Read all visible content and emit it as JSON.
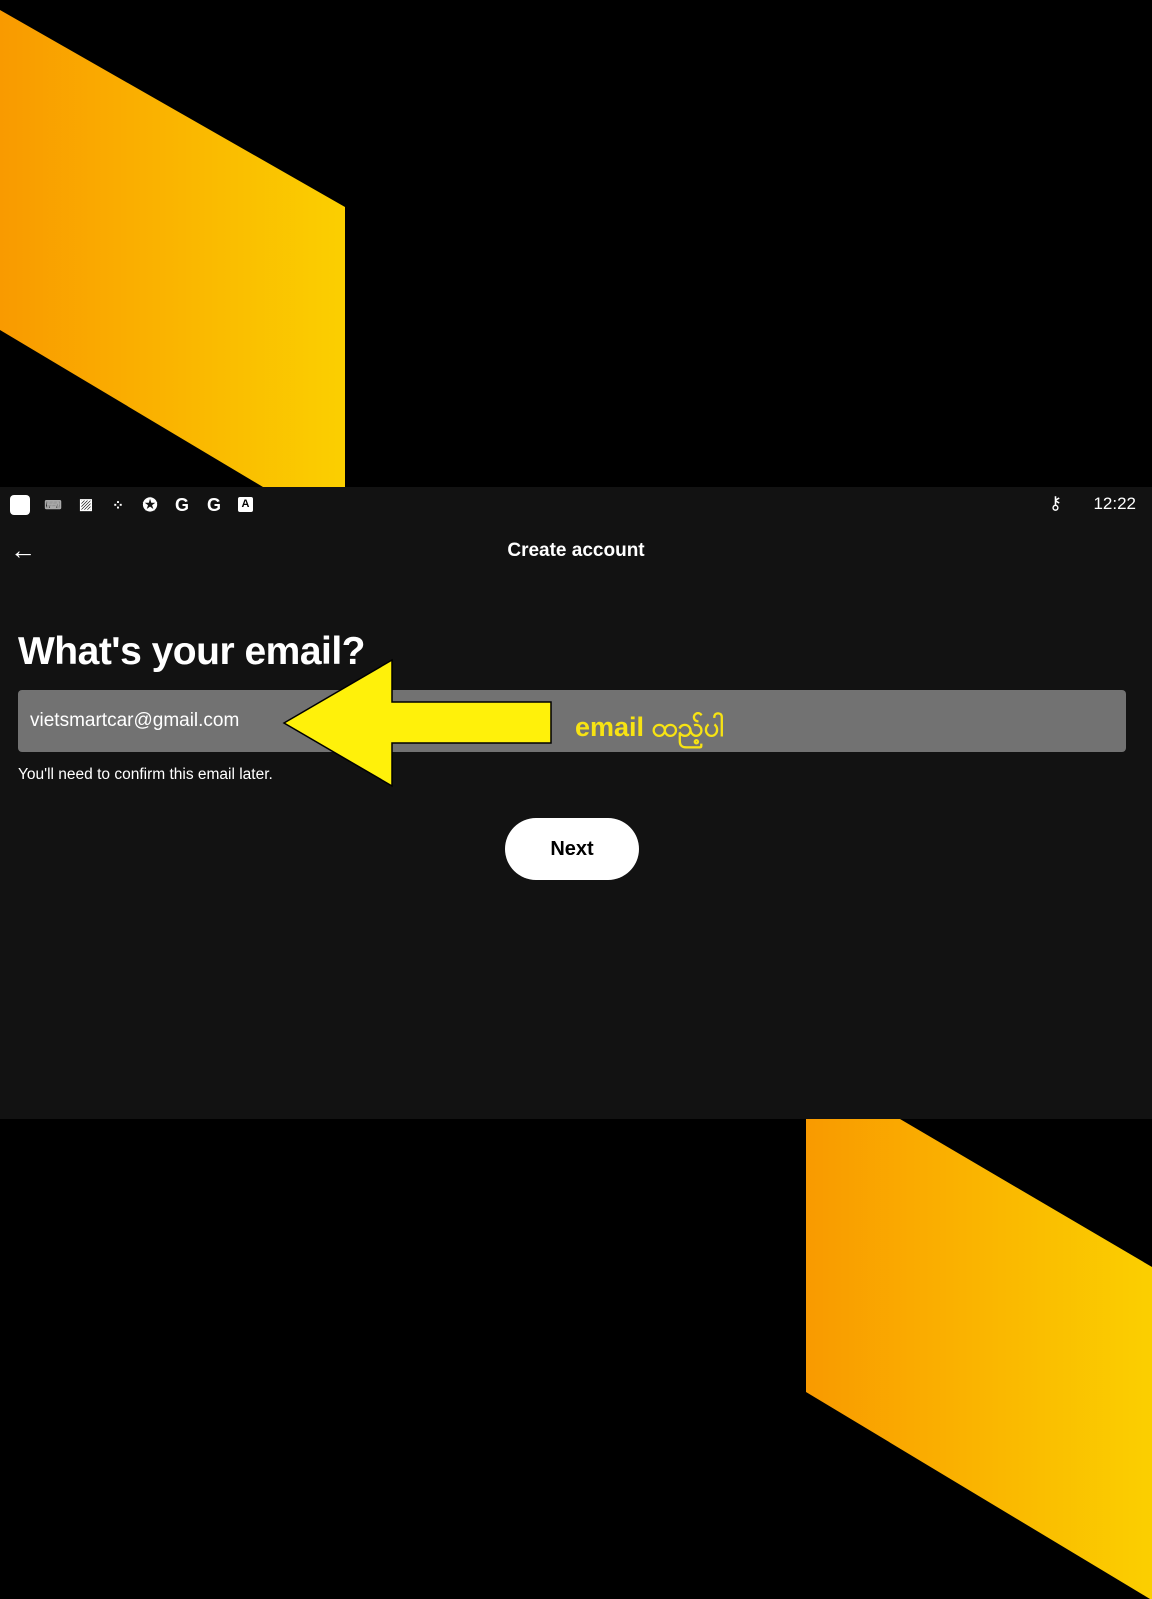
{
  "status_bar": {
    "icons": [
      "app-icon",
      "keyboard-icon",
      "image-alert-icon",
      "assistant-icon",
      "badge-icon",
      "google-icon",
      "google-icon",
      "a-letter-icon"
    ],
    "google_letter": "G",
    "a_letter": "A",
    "vpn_key": "key-icon",
    "time": "12:22"
  },
  "header": {
    "back": "←",
    "title": "Create account"
  },
  "form": {
    "heading": "What's your email?",
    "email_value": "vietsmartcar@gmail.com",
    "hint": "You'll need to confirm this email later.",
    "next_label": "Next"
  },
  "annotation": {
    "text": "email ထည့်ပါ",
    "color": "#f7e313"
  },
  "colors": {
    "accent_orange": "#f99a00",
    "accent_yellow": "#fbcf00",
    "background": "#121212",
    "input": "#727272"
  }
}
